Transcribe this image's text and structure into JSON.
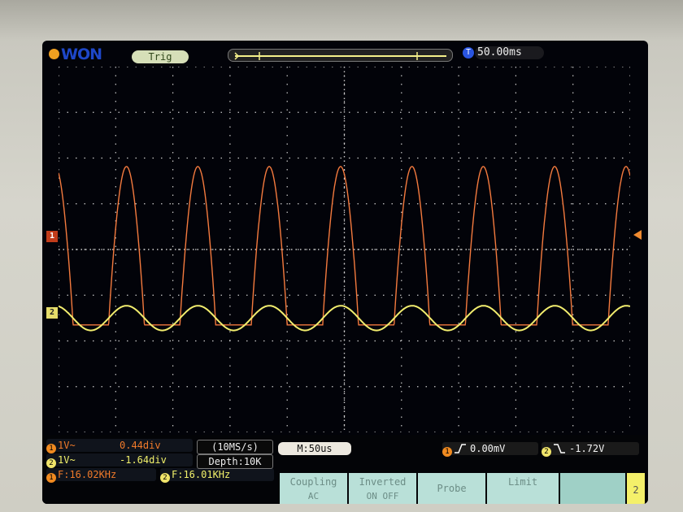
{
  "header": {
    "brand": "WON",
    "trigger_status": "Trig",
    "timebase_position": "50.00ms"
  },
  "channels": [
    {
      "id": "1",
      "scale": "1V~",
      "position": "0.44div",
      "frequency": "F:16.02KHz",
      "color": "#f47a3e"
    },
    {
      "id": "2",
      "scale": "1V~",
      "position": "-1.64div",
      "frequency": "F:16.01KHz",
      "color": "#f2ed6e"
    }
  ],
  "acquisition": {
    "sample_rate": "(10MS/s)",
    "depth": "Depth:10K",
    "horizontal": "M:50us"
  },
  "triggers": [
    {
      "channel": "1",
      "level": "0.00mV"
    },
    {
      "channel": "2",
      "level": "-1.72V"
    }
  ],
  "softmenu": [
    {
      "label": "Coupling",
      "value": "AC"
    },
    {
      "label": "Inverted",
      "value": "ON  OFF"
    },
    {
      "label": "Probe",
      "value": ""
    },
    {
      "label": "Limit",
      "value": ""
    }
  ],
  "active_channel_tab": "2",
  "waveforms": {
    "ch1": {
      "type": "rectified-sine",
      "frequency_khz": 16.02,
      "amplitude_div": 3.3
    },
    "ch2": {
      "type": "sine",
      "frequency_khz": 16.01,
      "amplitude_div": 0.45
    }
  },
  "colors": {
    "grid": "#c9c9c9",
    "ch1": "#f47a3e",
    "ch2": "#f2ed6e",
    "screen": "#020309"
  }
}
